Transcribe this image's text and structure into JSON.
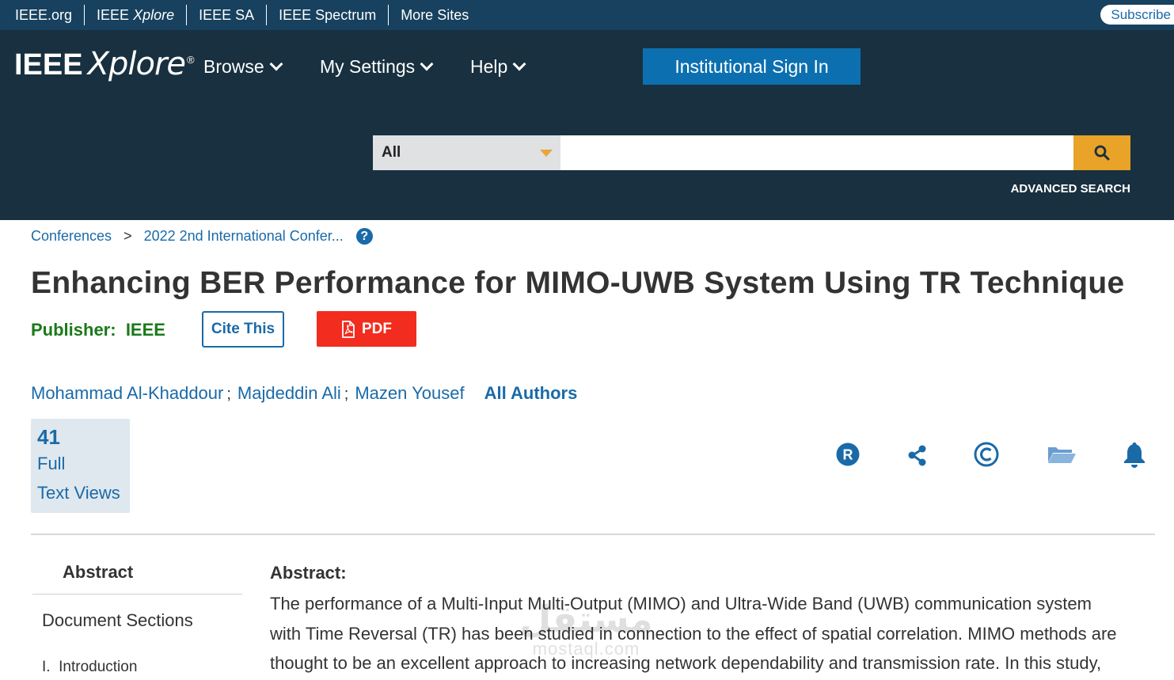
{
  "topbar": {
    "links": [
      "IEEE.org",
      "IEEE Xplore",
      "IEEE SA",
      "IEEE Spectrum",
      "More Sites"
    ],
    "subscribe": "Subscribe"
  },
  "header": {
    "logo_main": "IEEE",
    "logo_script": "Xplore",
    "logo_reg": "®",
    "nav": [
      "Browse",
      "My Settings",
      "Help"
    ],
    "signin": "Institutional Sign In",
    "search": {
      "scope": "All",
      "value": "",
      "placeholder": ""
    },
    "advanced_search": "ADVANCED SEARCH"
  },
  "breadcrumb": {
    "items": [
      "Conferences",
      "2022 2nd International Confer..."
    ],
    "separator": ">",
    "help": "?"
  },
  "article": {
    "title": "Enhancing BER Performance for MIMO-UWB System Using TR Technique",
    "publisher_label": "Publisher:",
    "publisher": "IEEE",
    "cite_label": "Cite This",
    "pdf_label": "PDF",
    "authors": [
      "Mohammad Al-Khaddour",
      "Majdeddin Ali",
      "Mazen Yousef"
    ],
    "author_separator": ";",
    "all_authors": "All Authors",
    "views": {
      "count": "41",
      "label_line1": "Full",
      "label_line2": "Text Views"
    },
    "action_icons": [
      "rights-r-icon",
      "share-icon",
      "copyright-icon",
      "folder-icon",
      "bell-icon"
    ]
  },
  "sidebar": {
    "abstract": "Abstract",
    "document_sections": "Document Sections",
    "intro": "I.  Introduction"
  },
  "abstract": {
    "heading": "Abstract:",
    "lines": [
      "The performance of a Multi-Input Multi-Output (MIMO) and Ultra-Wide Band (UWB) communication system",
      "with Time Reversal (TR) has been studied in connection to the effect of spatial correlation. MIMO methods are",
      "thought to be an excellent approach to increasing network dependability and transmission rate. In this study,"
    ]
  },
  "watermark": {
    "arabic": "مستقل",
    "latin": "mostaql.com"
  },
  "colors": {
    "topbar": "#17415e",
    "header": "#18303f",
    "link_blue": "#1a6aa8",
    "signin": "#0c70b0",
    "search_button": "#e8a328",
    "pdf_red": "#f22c1e",
    "publisher_green": "#1a7a1a"
  }
}
